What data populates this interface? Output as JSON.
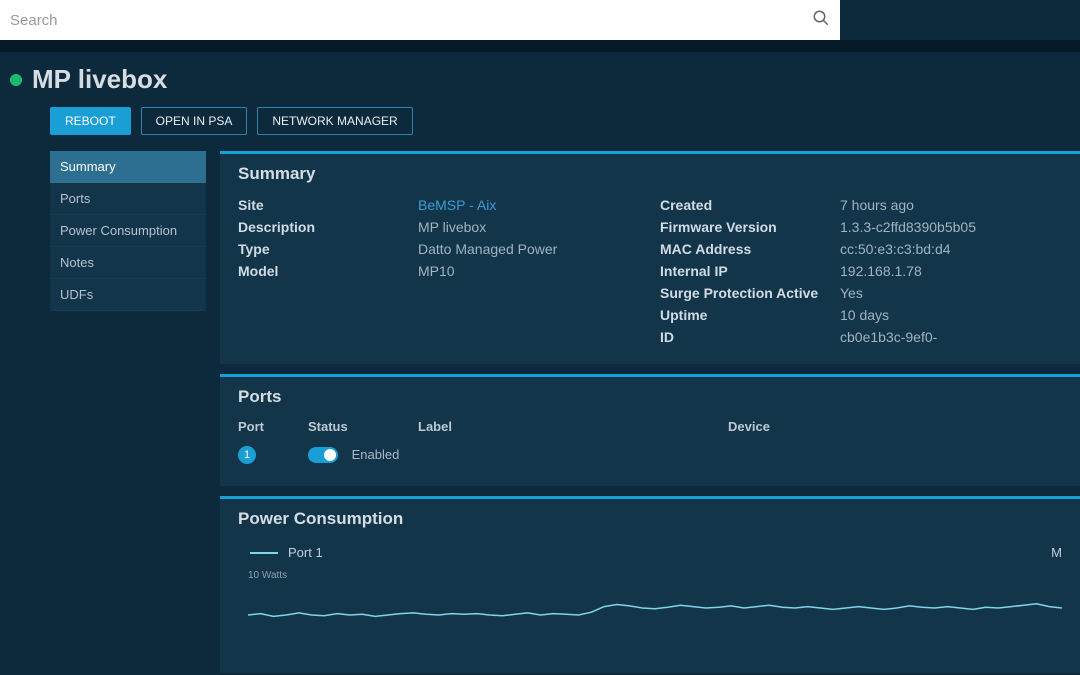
{
  "search": {
    "placeholder": "Search"
  },
  "header": {
    "title": "MP livebox"
  },
  "actions": {
    "reboot": "REBOOT",
    "open_psa": "OPEN IN PSA",
    "network_manager": "NETWORK MANAGER"
  },
  "sidebar": {
    "items": [
      {
        "label": "Summary",
        "active": true
      },
      {
        "label": "Ports"
      },
      {
        "label": "Power Consumption"
      },
      {
        "label": "Notes"
      },
      {
        "label": "UDFs"
      }
    ]
  },
  "summary": {
    "title": "Summary",
    "left": {
      "site_label": "Site",
      "site_value": "BeMSP - Aix",
      "description_label": "Description",
      "description_value": "MP livebox",
      "type_label": "Type",
      "type_value": "Datto Managed Power",
      "model_label": "Model",
      "model_value": "MP10"
    },
    "right": {
      "created_label": "Created",
      "created_value": "7 hours ago",
      "firmware_label": "Firmware Version",
      "firmware_value": "1.3.3-c2ffd8390b5b05",
      "mac_label": "MAC Address",
      "mac_value": "cc:50:e3:c3:bd:d4",
      "ip_label": "Internal IP",
      "ip_value": "192.168.1.78",
      "surge_label": "Surge Protection Active",
      "surge_value": "Yes",
      "uptime_label": "Uptime",
      "uptime_value": "10 days",
      "id_label": "ID",
      "id_value": "cb0e1b3c-9ef0-"
    }
  },
  "ports": {
    "title": "Ports",
    "columns": {
      "port": "Port",
      "status": "Status",
      "label": "Label",
      "device": "Device"
    },
    "rows": [
      {
        "port": "1",
        "status": "Enabled",
        "label": "",
        "device": ""
      }
    ]
  },
  "power": {
    "title": "Power Consumption",
    "legend_port": "Port 1",
    "legend_right": "M",
    "y_label": "10 Watts"
  },
  "chart_data": {
    "type": "line",
    "title": "Power Consumption",
    "ylabel": "Watts",
    "ylim": [
      0,
      10
    ],
    "series": [
      {
        "name": "Port 1",
        "values": [
          6,
          6.2,
          5.8,
          6,
          6.3,
          6,
          5.9,
          6.2,
          6,
          6.1,
          5.8,
          6,
          6.2,
          6.3,
          6.1,
          6.0,
          6.2,
          6.1,
          6.2,
          6.0,
          5.9,
          6.1,
          6.3,
          6.0,
          6.2,
          6.1,
          6.0,
          6.4,
          7.2,
          7.5,
          7.3,
          7.0,
          6.9,
          7.1,
          7.4,
          7.2,
          7.0,
          7.1,
          7.3,
          7.0,
          7.2,
          7.4,
          7.1,
          7.0,
          7.2,
          7.0,
          6.8,
          7.0,
          7.2,
          7.0,
          6.8,
          7.0,
          7.3,
          7.1,
          7.0,
          7.2,
          7.0,
          6.8,
          7.1,
          7.0,
          7.2,
          7.4,
          7.6,
          7.2,
          7.0
        ]
      }
    ]
  }
}
